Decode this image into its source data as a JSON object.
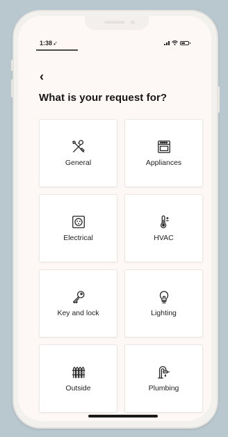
{
  "status": {
    "time": "1:38",
    "location_glyph": "➶"
  },
  "header": {
    "back_glyph": "‹",
    "title": "What is your request for?"
  },
  "categories": [
    {
      "label": "General",
      "icon": "tools-icon"
    },
    {
      "label": "Appliances",
      "icon": "oven-icon"
    },
    {
      "label": "Electrical",
      "icon": "outlet-icon"
    },
    {
      "label": "HVAC",
      "icon": "thermometer-icon"
    },
    {
      "label": "Key and lock",
      "icon": "key-icon"
    },
    {
      "label": "Lighting",
      "icon": "lightbulb-icon"
    },
    {
      "label": "Outside",
      "icon": "fence-icon"
    },
    {
      "label": "Plumbing",
      "icon": "faucet-icon"
    }
  ],
  "colors": {
    "background": "#b9c7cf",
    "screen": "#fdf8f6",
    "tile": "#ffffff",
    "text": "#151515"
  }
}
